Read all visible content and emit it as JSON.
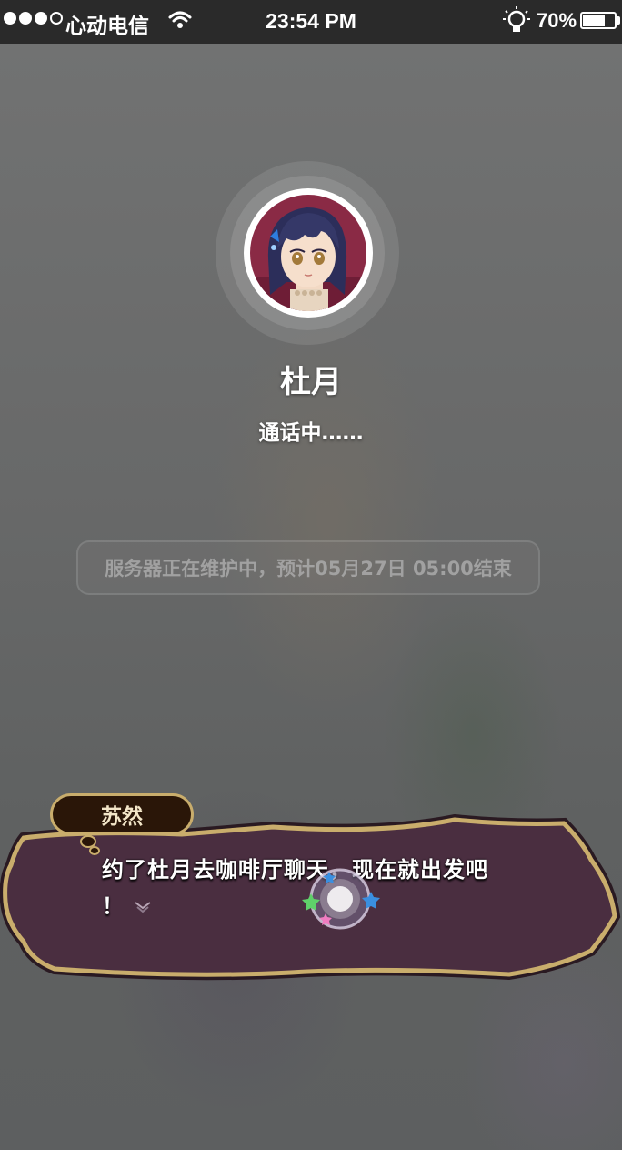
{
  "status_bar": {
    "carrier": "心动电信",
    "time": "23:54 PM",
    "battery_percent": "70%",
    "battery_level": 0.7,
    "signal_bars": 4,
    "signal_filled": 3
  },
  "call": {
    "caller_name": "杜月",
    "status": "通话中……",
    "avatar_icon": "character-portrait-icon"
  },
  "notice": {
    "text": "服务器正在维护中，预计05月27日 05:00结束"
  },
  "dialogue": {
    "speaker": "苏然",
    "line1": "约了杜月去咖啡厅聊天，现在就出发吧",
    "line2": "！",
    "more_icon": "chevron-down-icon",
    "skip_icon": "star-orb-icon"
  },
  "colors": {
    "status_bar_bg": "#2a2a2a",
    "dialog_fill": "#4a2e40",
    "dialog_border": "#c9ad6c",
    "speaker_tag_bg": "#2a1608"
  }
}
